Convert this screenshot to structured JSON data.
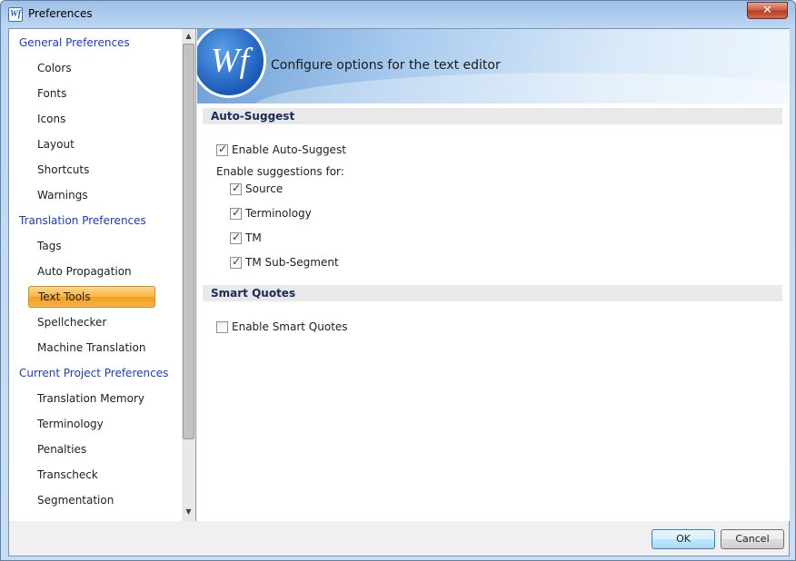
{
  "window": {
    "title": "Preferences",
    "app_icon_text": "Wf",
    "close_label": "✕"
  },
  "sidebar": {
    "items": [
      {
        "label": "General Preferences",
        "kind": "group"
      },
      {
        "label": "Colors",
        "kind": "child"
      },
      {
        "label": "Fonts",
        "kind": "child"
      },
      {
        "label": "Icons",
        "kind": "child"
      },
      {
        "label": "Layout",
        "kind": "child"
      },
      {
        "label": "Shortcuts",
        "kind": "child"
      },
      {
        "label": "Warnings",
        "kind": "child"
      },
      {
        "label": "Translation Preferences",
        "kind": "group"
      },
      {
        "label": "Tags",
        "kind": "child"
      },
      {
        "label": "Auto Propagation",
        "kind": "child"
      },
      {
        "label": "Text Tools",
        "kind": "child",
        "selected": true
      },
      {
        "label": "Spellchecker",
        "kind": "child"
      },
      {
        "label": "Machine Translation",
        "kind": "child"
      },
      {
        "label": "Current Project Preferences",
        "kind": "group"
      },
      {
        "label": "Translation Memory",
        "kind": "child"
      },
      {
        "label": "Terminology",
        "kind": "child"
      },
      {
        "label": "Penalties",
        "kind": "child"
      },
      {
        "label": "Transcheck",
        "kind": "child"
      },
      {
        "label": "Segmentation",
        "kind": "child"
      }
    ],
    "scroll_up": "▲",
    "scroll_down": "▼"
  },
  "banner": {
    "logo_text": "Wf",
    "description": "Configure options for the text editor"
  },
  "auto_suggest": {
    "header": "Auto-Suggest",
    "enable_label": "Enable Auto-Suggest",
    "enable_checked": true,
    "suggestions_for_label": "Enable suggestions for:",
    "options": [
      {
        "label": "Source",
        "checked": true
      },
      {
        "label": "Terminology",
        "checked": true
      },
      {
        "label": "TM",
        "checked": true
      },
      {
        "label": "TM Sub-Segment",
        "checked": true
      }
    ]
  },
  "smart_quotes": {
    "header": "Smart Quotes",
    "enable_label": "Enable Smart Quotes",
    "enable_checked": false
  },
  "footer": {
    "ok_label": "OK",
    "cancel_label": "Cancel"
  }
}
